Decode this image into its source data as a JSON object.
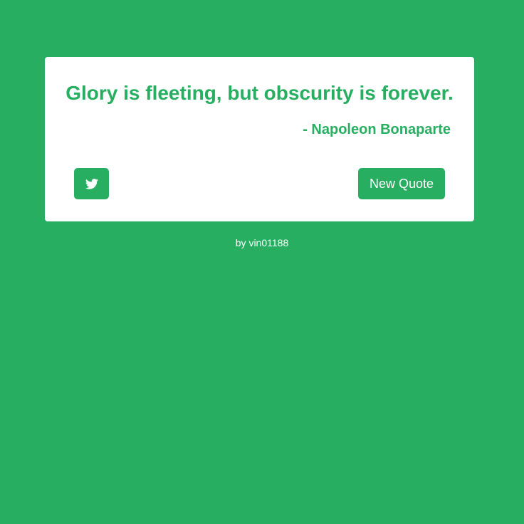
{
  "theme": {
    "accent": "#27ae60",
    "card_background": "#ffffff",
    "text_on_accent": "#ffffff"
  },
  "quote": {
    "text": "Glory is fleeting, but obscurity is forever.",
    "author": "- Napoleon Bonaparte"
  },
  "actions": {
    "tweet_icon": "twitter-icon",
    "new_quote_label": "New Quote"
  },
  "footer": {
    "credit": "by vin01188"
  }
}
